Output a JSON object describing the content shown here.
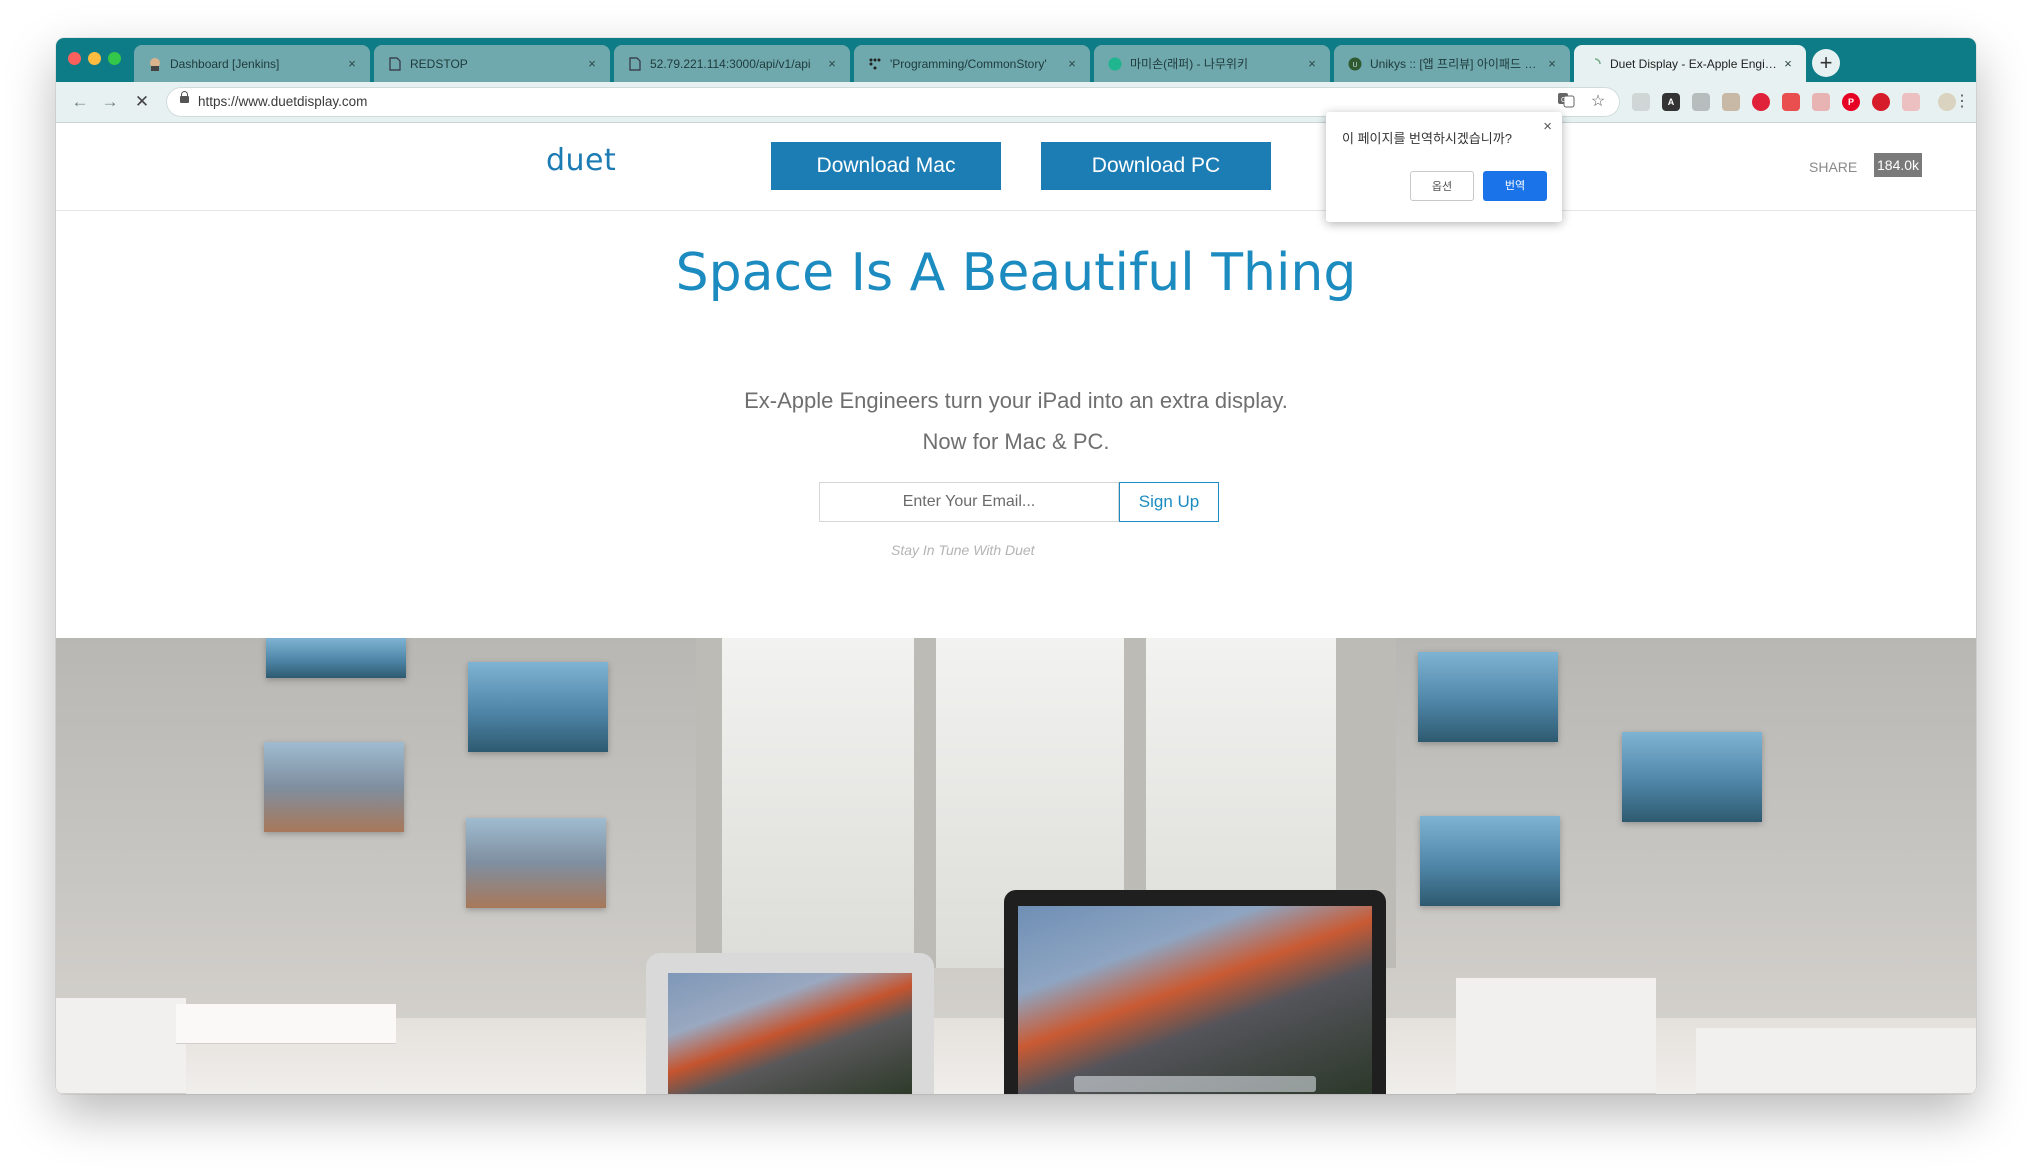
{
  "browser": {
    "tabs": [
      {
        "title": "Dashboard [Jenkins]",
        "favicon": "jenkins-icon",
        "active": false
      },
      {
        "title": "REDSTOP",
        "favicon": "document-icon",
        "active": false
      },
      {
        "title": "52.79.221.114:3000/api/v1/api",
        "favicon": "document-icon",
        "active": false
      },
      {
        "title": "'Programming/CommonStory'",
        "favicon": "dots-icon",
        "active": false
      },
      {
        "title": "마미손(래퍼) - 나무위키",
        "favicon": "namuwiki-icon",
        "active": false
      },
      {
        "title": "Unikys :: [앱 프리뷰] 아이패드 듀얼",
        "favicon": "unikys-icon",
        "active": false
      },
      {
        "title": "Duet Display - Ex-Apple Engineers",
        "favicon": "loading-icon",
        "active": true
      }
    ],
    "tab_close_glyph": "×",
    "new_tab_glyph": "+",
    "url": "https://www.duetdisplay.com",
    "nav": {
      "back": "←",
      "forward": "→",
      "stop": "✕"
    },
    "star_glyph": "☆",
    "menu_glyph": "⋮"
  },
  "site": {
    "logo": "duet",
    "download_mac": "Download Mac",
    "download_pc": "Download PC",
    "share_label": "SHARE",
    "share_count": "184.0k",
    "title": "Space Is A Beautiful Thing",
    "subtitle_line1": "Ex-Apple Engineers turn your iPad into an extra display.",
    "subtitle_line2": "Now for Mac & PC.",
    "email_placeholder": "Enter Your Email...",
    "signup_label": "Sign Up",
    "tagline": "Stay In Tune With Duet"
  },
  "translate_popup": {
    "question": "이 페이지를 번역하시겠습니까?",
    "options_label": "옵션",
    "translate_label": "번역",
    "close_glyph": "×"
  },
  "colors": {
    "tab_strip": "#0e7c86",
    "brand_blue": "#1c7db5",
    "title_blue": "#1b8bc0",
    "translate_button": "#1a73e8"
  }
}
